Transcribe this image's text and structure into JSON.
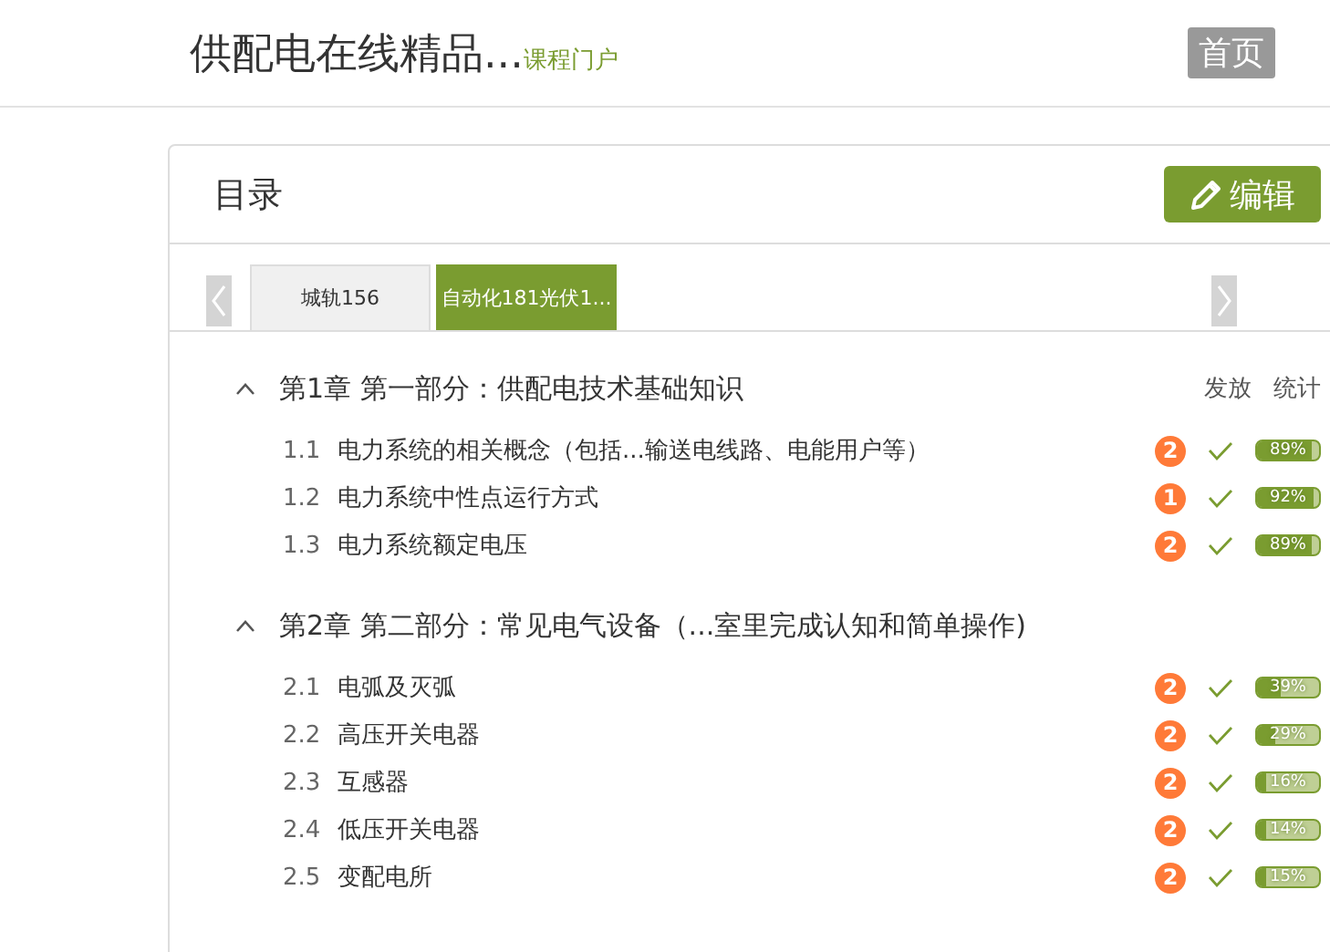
{
  "header": {
    "title": "供配电在线精品...",
    "subtitle": "课程门户",
    "nav": [
      {
        "label": "首页",
        "selected": true
      }
    ]
  },
  "panel": {
    "title": "目录",
    "edit_button": "编辑",
    "tabs": [
      {
        "label": "城轨156",
        "selected": false
      },
      {
        "label": "自动化181光伏1...",
        "selected": true
      }
    ],
    "column_headers": [
      "发放",
      "统计"
    ],
    "chapters": [
      {
        "title": "第1章 第一部分：供配电技术基础知识",
        "expanded": true,
        "children": [
          {
            "number": "1.1",
            "title": "电力系统的相关概念（包括...输送电线路、电能用户等）",
            "count": "2",
            "released": true,
            "level": 0.89,
            "reading": "89%"
          },
          {
            "number": "1.2",
            "title": "电力系统中性点运行方式",
            "count": "1",
            "released": true,
            "level": 0.92,
            "reading": "92%"
          },
          {
            "number": "1.3",
            "title": "电力系统额定电压",
            "count": "2",
            "released": true,
            "level": 0.89,
            "reading": "89%"
          }
        ]
      },
      {
        "title": "第2章 第二部分：常见电气设备（...室里完成认知和简单操作)",
        "expanded": true,
        "children": [
          {
            "number": "2.1",
            "title": "电弧及灭弧",
            "count": "2",
            "released": true,
            "level": 0.39,
            "reading": "39%"
          },
          {
            "number": "2.2",
            "title": "高压开关电器",
            "count": "2",
            "released": true,
            "level": 0.29,
            "reading": "29%"
          },
          {
            "number": "2.3",
            "title": "互感器",
            "count": "2",
            "released": true,
            "level": 0.16,
            "reading": "16%"
          },
          {
            "number": "2.4",
            "title": "低压开关电器",
            "count": "2",
            "released": true,
            "level": 0.14,
            "reading": "14%"
          },
          {
            "number": "2.5",
            "title": "变配电所",
            "count": "2",
            "released": true,
            "level": 0.15,
            "reading": "15%"
          }
        ]
      }
    ]
  }
}
